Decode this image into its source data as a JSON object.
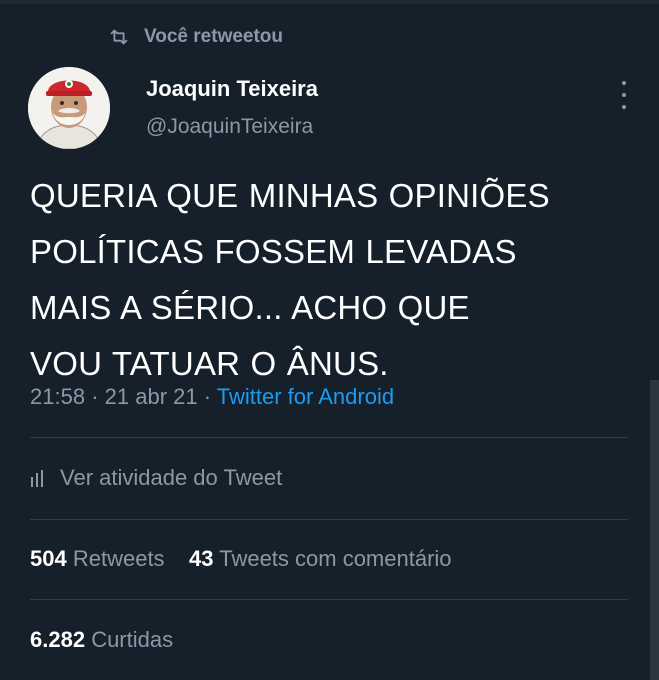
{
  "retweet_context": {
    "icon": "retweet-icon",
    "label": "Você retweetou"
  },
  "author": {
    "display_name": "Joaquin Teixeira",
    "handle": "@JoaquinTeixeira",
    "avatar": "avatar-illustration"
  },
  "tweet": {
    "text": "QUERIA QUE MINHAS OPINIÕES\nPOLÍTICAS FOSSEM LEVADAS\nMAIS A SÉRIO... ACHO QUE\nVOU TATUAR O ÂNUS.",
    "time": "21:58",
    "separator": "·",
    "date": "21 abr 21",
    "source": "Twitter for Android"
  },
  "activity": {
    "icon": "analytics-bars-icon",
    "label": "Ver atividade do Tweet"
  },
  "stats": {
    "retweets_count": "504",
    "retweets_label": "Retweets",
    "comments_count": "43",
    "comments_label": "Tweets com comentário",
    "likes_count": "6.282",
    "likes_label": "Curtidas"
  },
  "colors": {
    "background": "#15202b",
    "text": "#ffffff",
    "secondary": "#8b98a5",
    "link": "#1d9bf0",
    "divider": "#2f3b47"
  }
}
